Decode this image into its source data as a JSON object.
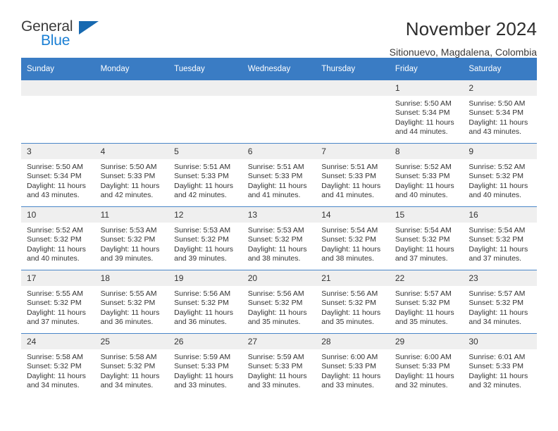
{
  "brand": {
    "name_dark": "General",
    "name_blue": "Blue",
    "triangle_icon": "triangle-icon",
    "accent_color": "#1a7fd4",
    "triangle_color": "#1769b0"
  },
  "header": {
    "title": "November 2024",
    "location": "Sitionuevo, Magdalena, Colombia"
  },
  "calendar": {
    "header_bg": "#3a7cc4",
    "header_text_color": "#ffffff",
    "daynum_bg": "#efefef",
    "row_border_color": "#4a86c8",
    "weekdays": [
      "Sunday",
      "Monday",
      "Tuesday",
      "Wednesday",
      "Thursday",
      "Friday",
      "Saturday"
    ],
    "weeks": [
      [
        {
          "day": "",
          "empty": true
        },
        {
          "day": "",
          "empty": true
        },
        {
          "day": "",
          "empty": true
        },
        {
          "day": "",
          "empty": true
        },
        {
          "day": "",
          "empty": true
        },
        {
          "day": "1",
          "sunrise": "Sunrise: 5:50 AM",
          "sunset": "Sunset: 5:34 PM",
          "daylight_line1": "Daylight: 11 hours",
          "daylight_line2": "and 44 minutes."
        },
        {
          "day": "2",
          "sunrise": "Sunrise: 5:50 AM",
          "sunset": "Sunset: 5:34 PM",
          "daylight_line1": "Daylight: 11 hours",
          "daylight_line2": "and 43 minutes."
        }
      ],
      [
        {
          "day": "3",
          "sunrise": "Sunrise: 5:50 AM",
          "sunset": "Sunset: 5:34 PM",
          "daylight_line1": "Daylight: 11 hours",
          "daylight_line2": "and 43 minutes."
        },
        {
          "day": "4",
          "sunrise": "Sunrise: 5:50 AM",
          "sunset": "Sunset: 5:33 PM",
          "daylight_line1": "Daylight: 11 hours",
          "daylight_line2": "and 42 minutes."
        },
        {
          "day": "5",
          "sunrise": "Sunrise: 5:51 AM",
          "sunset": "Sunset: 5:33 PM",
          "daylight_line1": "Daylight: 11 hours",
          "daylight_line2": "and 42 minutes."
        },
        {
          "day": "6",
          "sunrise": "Sunrise: 5:51 AM",
          "sunset": "Sunset: 5:33 PM",
          "daylight_line1": "Daylight: 11 hours",
          "daylight_line2": "and 41 minutes."
        },
        {
          "day": "7",
          "sunrise": "Sunrise: 5:51 AM",
          "sunset": "Sunset: 5:33 PM",
          "daylight_line1": "Daylight: 11 hours",
          "daylight_line2": "and 41 minutes."
        },
        {
          "day": "8",
          "sunrise": "Sunrise: 5:52 AM",
          "sunset": "Sunset: 5:33 PM",
          "daylight_line1": "Daylight: 11 hours",
          "daylight_line2": "and 40 minutes."
        },
        {
          "day": "9",
          "sunrise": "Sunrise: 5:52 AM",
          "sunset": "Sunset: 5:32 PM",
          "daylight_line1": "Daylight: 11 hours",
          "daylight_line2": "and 40 minutes."
        }
      ],
      [
        {
          "day": "10",
          "sunrise": "Sunrise: 5:52 AM",
          "sunset": "Sunset: 5:32 PM",
          "daylight_line1": "Daylight: 11 hours",
          "daylight_line2": "and 40 minutes."
        },
        {
          "day": "11",
          "sunrise": "Sunrise: 5:53 AM",
          "sunset": "Sunset: 5:32 PM",
          "daylight_line1": "Daylight: 11 hours",
          "daylight_line2": "and 39 minutes."
        },
        {
          "day": "12",
          "sunrise": "Sunrise: 5:53 AM",
          "sunset": "Sunset: 5:32 PM",
          "daylight_line1": "Daylight: 11 hours",
          "daylight_line2": "and 39 minutes."
        },
        {
          "day": "13",
          "sunrise": "Sunrise: 5:53 AM",
          "sunset": "Sunset: 5:32 PM",
          "daylight_line1": "Daylight: 11 hours",
          "daylight_line2": "and 38 minutes."
        },
        {
          "day": "14",
          "sunrise": "Sunrise: 5:54 AM",
          "sunset": "Sunset: 5:32 PM",
          "daylight_line1": "Daylight: 11 hours",
          "daylight_line2": "and 38 minutes."
        },
        {
          "day": "15",
          "sunrise": "Sunrise: 5:54 AM",
          "sunset": "Sunset: 5:32 PM",
          "daylight_line1": "Daylight: 11 hours",
          "daylight_line2": "and 37 minutes."
        },
        {
          "day": "16",
          "sunrise": "Sunrise: 5:54 AM",
          "sunset": "Sunset: 5:32 PM",
          "daylight_line1": "Daylight: 11 hours",
          "daylight_line2": "and 37 minutes."
        }
      ],
      [
        {
          "day": "17",
          "sunrise": "Sunrise: 5:55 AM",
          "sunset": "Sunset: 5:32 PM",
          "daylight_line1": "Daylight: 11 hours",
          "daylight_line2": "and 37 minutes."
        },
        {
          "day": "18",
          "sunrise": "Sunrise: 5:55 AM",
          "sunset": "Sunset: 5:32 PM",
          "daylight_line1": "Daylight: 11 hours",
          "daylight_line2": "and 36 minutes."
        },
        {
          "day": "19",
          "sunrise": "Sunrise: 5:56 AM",
          "sunset": "Sunset: 5:32 PM",
          "daylight_line1": "Daylight: 11 hours",
          "daylight_line2": "and 36 minutes."
        },
        {
          "day": "20",
          "sunrise": "Sunrise: 5:56 AM",
          "sunset": "Sunset: 5:32 PM",
          "daylight_line1": "Daylight: 11 hours",
          "daylight_line2": "and 35 minutes."
        },
        {
          "day": "21",
          "sunrise": "Sunrise: 5:56 AM",
          "sunset": "Sunset: 5:32 PM",
          "daylight_line1": "Daylight: 11 hours",
          "daylight_line2": "and 35 minutes."
        },
        {
          "day": "22",
          "sunrise": "Sunrise: 5:57 AM",
          "sunset": "Sunset: 5:32 PM",
          "daylight_line1": "Daylight: 11 hours",
          "daylight_line2": "and 35 minutes."
        },
        {
          "day": "23",
          "sunrise": "Sunrise: 5:57 AM",
          "sunset": "Sunset: 5:32 PM",
          "daylight_line1": "Daylight: 11 hours",
          "daylight_line2": "and 34 minutes."
        }
      ],
      [
        {
          "day": "24",
          "sunrise": "Sunrise: 5:58 AM",
          "sunset": "Sunset: 5:32 PM",
          "daylight_line1": "Daylight: 11 hours",
          "daylight_line2": "and 34 minutes."
        },
        {
          "day": "25",
          "sunrise": "Sunrise: 5:58 AM",
          "sunset": "Sunset: 5:32 PM",
          "daylight_line1": "Daylight: 11 hours",
          "daylight_line2": "and 34 minutes."
        },
        {
          "day": "26",
          "sunrise": "Sunrise: 5:59 AM",
          "sunset": "Sunset: 5:33 PM",
          "daylight_line1": "Daylight: 11 hours",
          "daylight_line2": "and 33 minutes."
        },
        {
          "day": "27",
          "sunrise": "Sunrise: 5:59 AM",
          "sunset": "Sunset: 5:33 PM",
          "daylight_line1": "Daylight: 11 hours",
          "daylight_line2": "and 33 minutes."
        },
        {
          "day": "28",
          "sunrise": "Sunrise: 6:00 AM",
          "sunset": "Sunset: 5:33 PM",
          "daylight_line1": "Daylight: 11 hours",
          "daylight_line2": "and 33 minutes."
        },
        {
          "day": "29",
          "sunrise": "Sunrise: 6:00 AM",
          "sunset": "Sunset: 5:33 PM",
          "daylight_line1": "Daylight: 11 hours",
          "daylight_line2": "and 32 minutes."
        },
        {
          "day": "30",
          "sunrise": "Sunrise: 6:01 AM",
          "sunset": "Sunset: 5:33 PM",
          "daylight_line1": "Daylight: 11 hours",
          "daylight_line2": "and 32 minutes."
        }
      ]
    ]
  }
}
